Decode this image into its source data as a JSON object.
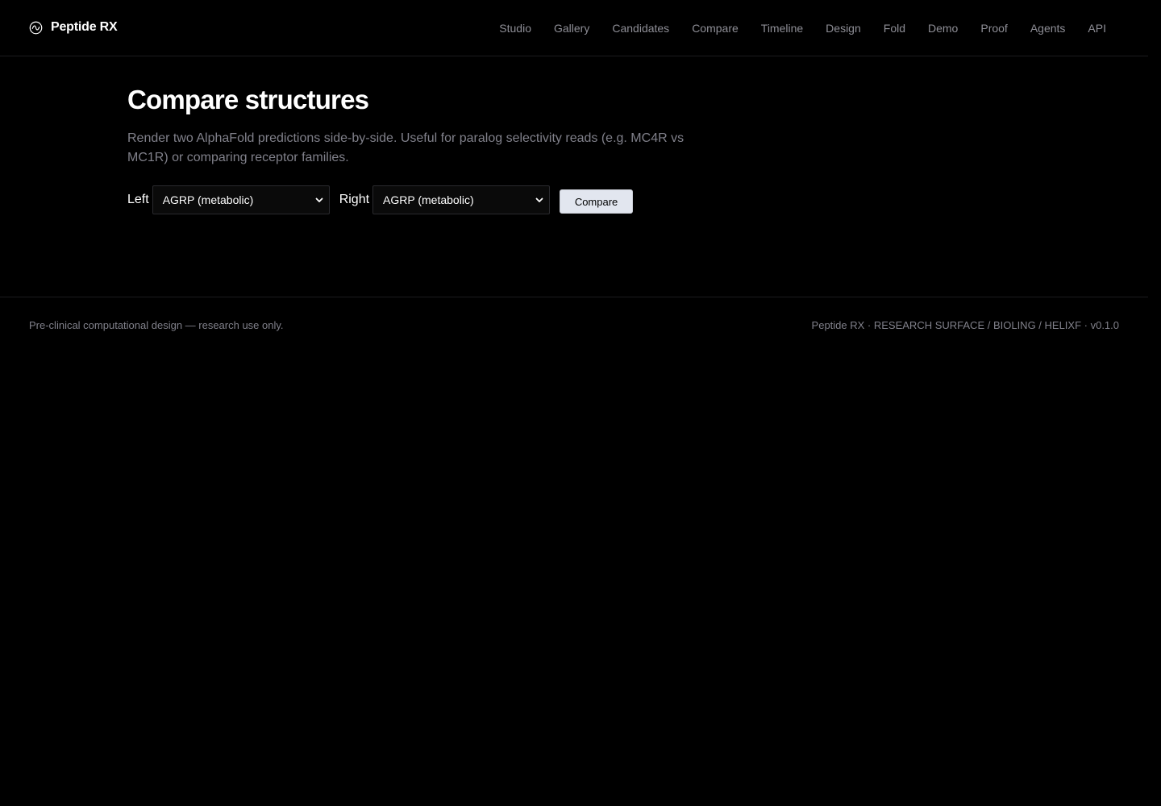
{
  "brand": {
    "name": "Peptide RX",
    "icon": "wave-circle-icon"
  },
  "nav": {
    "items": [
      {
        "label": "Studio"
      },
      {
        "label": "Gallery"
      },
      {
        "label": "Candidates"
      },
      {
        "label": "Compare"
      },
      {
        "label": "Timeline"
      },
      {
        "label": "Design"
      },
      {
        "label": "Fold"
      },
      {
        "label": "Demo"
      },
      {
        "label": "Proof"
      },
      {
        "label": "Agents"
      },
      {
        "label": "API"
      }
    ]
  },
  "main": {
    "title": "Compare structures",
    "description": "Render two AlphaFold predictions side-by-side. Useful for paralog selectivity reads (e.g. MC4R vs MC1R) or comparing receptor families.",
    "left_label": "Left",
    "left_value": "AGRP (metabolic)",
    "right_label": "Right",
    "right_value": "AGRP (metabolic)",
    "compare_label": "Compare"
  },
  "footer": {
    "left_text": "Pre-clinical computational design — research use only.",
    "right_text": "Peptide RX · RESEARCH SURFACE / BIOLING / HELIXF · v0.1.0"
  },
  "colors": {
    "background": "#000000",
    "muted_text": "#80808a",
    "button_bg": "#e2e6ef"
  }
}
